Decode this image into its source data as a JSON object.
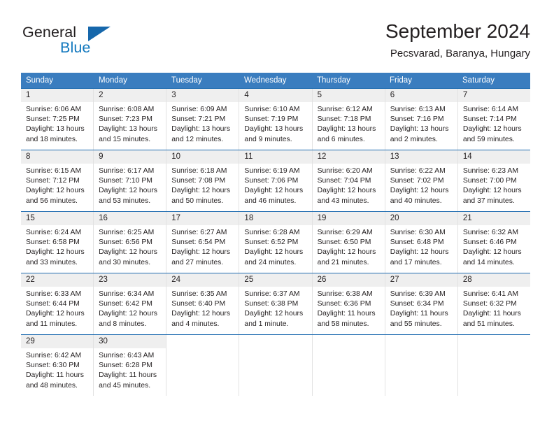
{
  "brand": {
    "word_one": "General",
    "word_two": "Blue",
    "mark_icon": "triangle-logo-icon",
    "colors": {
      "general": "#231f20",
      "blue": "#1278be",
      "mark": "#1667ab"
    }
  },
  "header": {
    "title": "September 2024",
    "subtitle": "Pecsvarad, Baranya, Hungary"
  },
  "theme": {
    "header_blue": "#3a7dbf",
    "row_rule_blue": "#1f6cb0",
    "daynum_band": "#efefef",
    "cell_divider": "#e2e2e2"
  },
  "calendar": {
    "weekdays": [
      "Sunday",
      "Monday",
      "Tuesday",
      "Wednesday",
      "Thursday",
      "Friday",
      "Saturday"
    ],
    "weeks": [
      [
        {
          "day": "1",
          "sunrise": "Sunrise: 6:06 AM",
          "sunset": "Sunset: 7:25 PM",
          "daylight_1": "Daylight: 13 hours",
          "daylight_2": "and 18 minutes."
        },
        {
          "day": "2",
          "sunrise": "Sunrise: 6:08 AM",
          "sunset": "Sunset: 7:23 PM",
          "daylight_1": "Daylight: 13 hours",
          "daylight_2": "and 15 minutes."
        },
        {
          "day": "3",
          "sunrise": "Sunrise: 6:09 AM",
          "sunset": "Sunset: 7:21 PM",
          "daylight_1": "Daylight: 13 hours",
          "daylight_2": "and 12 minutes."
        },
        {
          "day": "4",
          "sunrise": "Sunrise: 6:10 AM",
          "sunset": "Sunset: 7:19 PM",
          "daylight_1": "Daylight: 13 hours",
          "daylight_2": "and 9 minutes."
        },
        {
          "day": "5",
          "sunrise": "Sunrise: 6:12 AM",
          "sunset": "Sunset: 7:18 PM",
          "daylight_1": "Daylight: 13 hours",
          "daylight_2": "and 6 minutes."
        },
        {
          "day": "6",
          "sunrise": "Sunrise: 6:13 AM",
          "sunset": "Sunset: 7:16 PM",
          "daylight_1": "Daylight: 13 hours",
          "daylight_2": "and 2 minutes."
        },
        {
          "day": "7",
          "sunrise": "Sunrise: 6:14 AM",
          "sunset": "Sunset: 7:14 PM",
          "daylight_1": "Daylight: 12 hours",
          "daylight_2": "and 59 minutes."
        }
      ],
      [
        {
          "day": "8",
          "sunrise": "Sunrise: 6:15 AM",
          "sunset": "Sunset: 7:12 PM",
          "daylight_1": "Daylight: 12 hours",
          "daylight_2": "and 56 minutes."
        },
        {
          "day": "9",
          "sunrise": "Sunrise: 6:17 AM",
          "sunset": "Sunset: 7:10 PM",
          "daylight_1": "Daylight: 12 hours",
          "daylight_2": "and 53 minutes."
        },
        {
          "day": "10",
          "sunrise": "Sunrise: 6:18 AM",
          "sunset": "Sunset: 7:08 PM",
          "daylight_1": "Daylight: 12 hours",
          "daylight_2": "and 50 minutes."
        },
        {
          "day": "11",
          "sunrise": "Sunrise: 6:19 AM",
          "sunset": "Sunset: 7:06 PM",
          "daylight_1": "Daylight: 12 hours",
          "daylight_2": "and 46 minutes."
        },
        {
          "day": "12",
          "sunrise": "Sunrise: 6:20 AM",
          "sunset": "Sunset: 7:04 PM",
          "daylight_1": "Daylight: 12 hours",
          "daylight_2": "and 43 minutes."
        },
        {
          "day": "13",
          "sunrise": "Sunrise: 6:22 AM",
          "sunset": "Sunset: 7:02 PM",
          "daylight_1": "Daylight: 12 hours",
          "daylight_2": "and 40 minutes."
        },
        {
          "day": "14",
          "sunrise": "Sunrise: 6:23 AM",
          "sunset": "Sunset: 7:00 PM",
          "daylight_1": "Daylight: 12 hours",
          "daylight_2": "and 37 minutes."
        }
      ],
      [
        {
          "day": "15",
          "sunrise": "Sunrise: 6:24 AM",
          "sunset": "Sunset: 6:58 PM",
          "daylight_1": "Daylight: 12 hours",
          "daylight_2": "and 33 minutes."
        },
        {
          "day": "16",
          "sunrise": "Sunrise: 6:25 AM",
          "sunset": "Sunset: 6:56 PM",
          "daylight_1": "Daylight: 12 hours",
          "daylight_2": "and 30 minutes."
        },
        {
          "day": "17",
          "sunrise": "Sunrise: 6:27 AM",
          "sunset": "Sunset: 6:54 PM",
          "daylight_1": "Daylight: 12 hours",
          "daylight_2": "and 27 minutes."
        },
        {
          "day": "18",
          "sunrise": "Sunrise: 6:28 AM",
          "sunset": "Sunset: 6:52 PM",
          "daylight_1": "Daylight: 12 hours",
          "daylight_2": "and 24 minutes."
        },
        {
          "day": "19",
          "sunrise": "Sunrise: 6:29 AM",
          "sunset": "Sunset: 6:50 PM",
          "daylight_1": "Daylight: 12 hours",
          "daylight_2": "and 21 minutes."
        },
        {
          "day": "20",
          "sunrise": "Sunrise: 6:30 AM",
          "sunset": "Sunset: 6:48 PM",
          "daylight_1": "Daylight: 12 hours",
          "daylight_2": "and 17 minutes."
        },
        {
          "day": "21",
          "sunrise": "Sunrise: 6:32 AM",
          "sunset": "Sunset: 6:46 PM",
          "daylight_1": "Daylight: 12 hours",
          "daylight_2": "and 14 minutes."
        }
      ],
      [
        {
          "day": "22",
          "sunrise": "Sunrise: 6:33 AM",
          "sunset": "Sunset: 6:44 PM",
          "daylight_1": "Daylight: 12 hours",
          "daylight_2": "and 11 minutes."
        },
        {
          "day": "23",
          "sunrise": "Sunrise: 6:34 AM",
          "sunset": "Sunset: 6:42 PM",
          "daylight_1": "Daylight: 12 hours",
          "daylight_2": "and 8 minutes."
        },
        {
          "day": "24",
          "sunrise": "Sunrise: 6:35 AM",
          "sunset": "Sunset: 6:40 PM",
          "daylight_1": "Daylight: 12 hours",
          "daylight_2": "and 4 minutes."
        },
        {
          "day": "25",
          "sunrise": "Sunrise: 6:37 AM",
          "sunset": "Sunset: 6:38 PM",
          "daylight_1": "Daylight: 12 hours",
          "daylight_2": "and 1 minute."
        },
        {
          "day": "26",
          "sunrise": "Sunrise: 6:38 AM",
          "sunset": "Sunset: 6:36 PM",
          "daylight_1": "Daylight: 11 hours",
          "daylight_2": "and 58 minutes."
        },
        {
          "day": "27",
          "sunrise": "Sunrise: 6:39 AM",
          "sunset": "Sunset: 6:34 PM",
          "daylight_1": "Daylight: 11 hours",
          "daylight_2": "and 55 minutes."
        },
        {
          "day": "28",
          "sunrise": "Sunrise: 6:41 AM",
          "sunset": "Sunset: 6:32 PM",
          "daylight_1": "Daylight: 11 hours",
          "daylight_2": "and 51 minutes."
        }
      ],
      [
        {
          "day": "29",
          "sunrise": "Sunrise: 6:42 AM",
          "sunset": "Sunset: 6:30 PM",
          "daylight_1": "Daylight: 11 hours",
          "daylight_2": "and 48 minutes."
        },
        {
          "day": "30",
          "sunrise": "Sunrise: 6:43 AM",
          "sunset": "Sunset: 6:28 PM",
          "daylight_1": "Daylight: 11 hours",
          "daylight_2": "and 45 minutes."
        },
        {
          "day": "",
          "sunrise": "",
          "sunset": "",
          "daylight_1": "",
          "daylight_2": ""
        },
        {
          "day": "",
          "sunrise": "",
          "sunset": "",
          "daylight_1": "",
          "daylight_2": ""
        },
        {
          "day": "",
          "sunrise": "",
          "sunset": "",
          "daylight_1": "",
          "daylight_2": ""
        },
        {
          "day": "",
          "sunrise": "",
          "sunset": "",
          "daylight_1": "",
          "daylight_2": ""
        },
        {
          "day": "",
          "sunrise": "",
          "sunset": "",
          "daylight_1": "",
          "daylight_2": ""
        }
      ]
    ]
  }
}
